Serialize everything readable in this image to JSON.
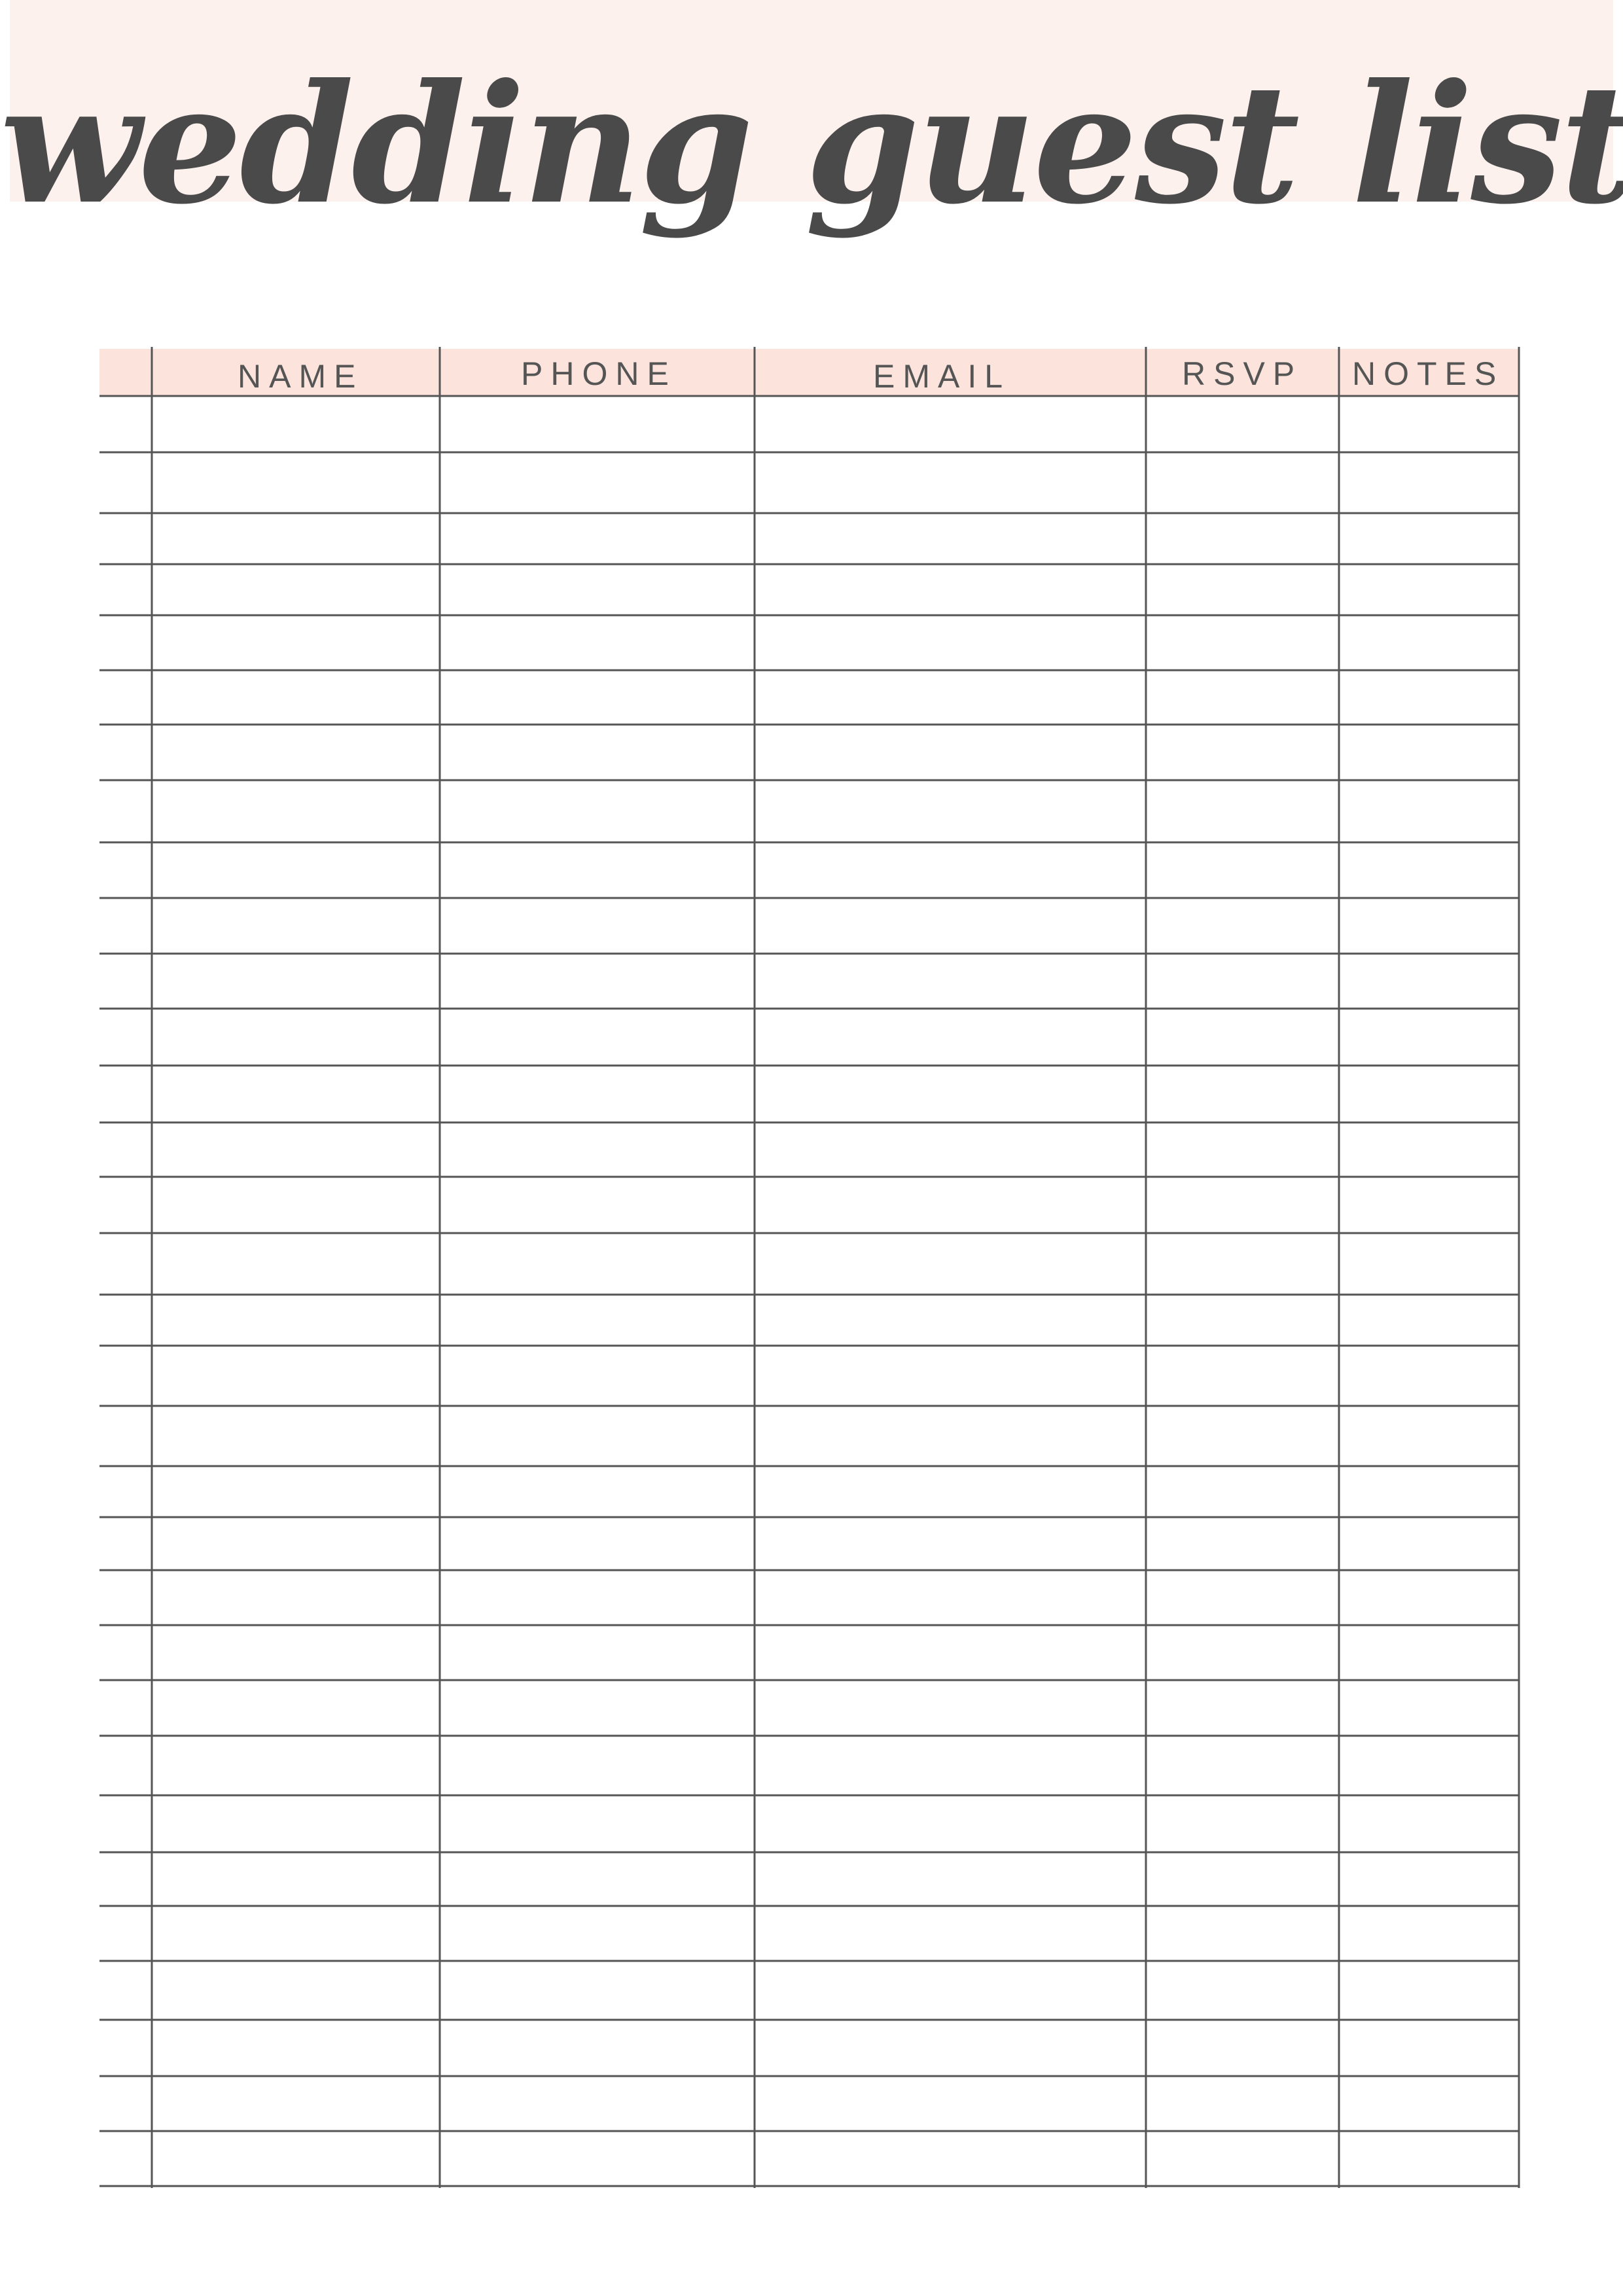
{
  "title": "wedding guest list",
  "colors": {
    "band": "#fdf1ee",
    "header_row": "#fce4dc",
    "line": "#555555",
    "title_text": "#4a4a4a"
  },
  "table": {
    "columns": [
      "NAME",
      "PHONE",
      "EMAIL",
      "RSVP",
      "NOTES"
    ],
    "blank_rows": 32
  }
}
